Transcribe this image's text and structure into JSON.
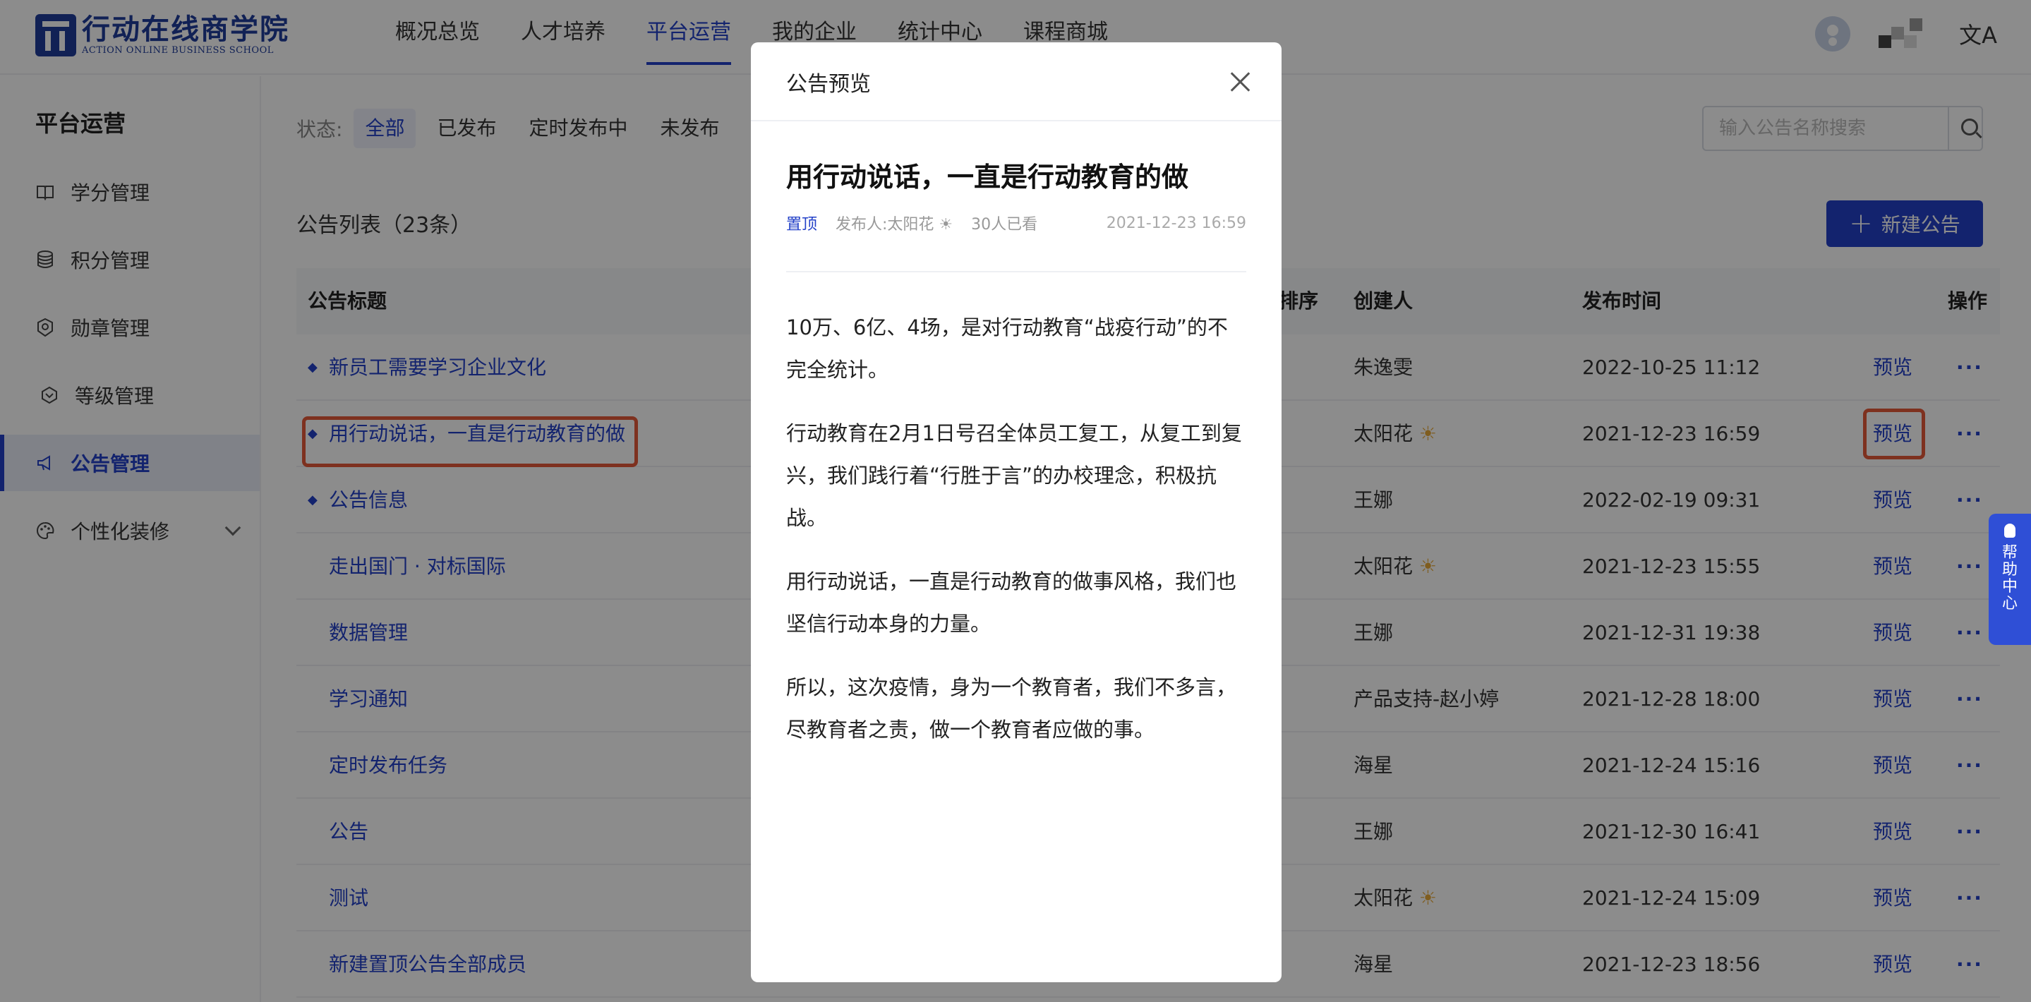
{
  "header": {
    "logo_cn": "行动在线商学院",
    "logo_en": "ACTION ONLINE BUSINESS SCHOOL",
    "nav": [
      {
        "label": "概况总览",
        "active": false
      },
      {
        "label": "人才培养",
        "active": false
      },
      {
        "label": "平台运营",
        "active": true
      },
      {
        "label": "我的企业",
        "active": false
      },
      {
        "label": "统计中心",
        "active": false
      },
      {
        "label": "课程商城",
        "active": false
      }
    ],
    "lang_icon": "translate-icon"
  },
  "sidebar": {
    "title": "平台运营",
    "items": [
      {
        "label": "学分管理",
        "icon": "book-icon"
      },
      {
        "label": "积分管理",
        "icon": "database-icon"
      },
      {
        "label": "勋章管理",
        "icon": "medal-icon"
      },
      {
        "label": "等级管理",
        "icon": "level-icon"
      },
      {
        "label": "公告管理",
        "icon": "megaphone-icon",
        "active": true
      },
      {
        "label": "个性化装修",
        "icon": "palette-icon"
      }
    ]
  },
  "filter": {
    "label": "状态:",
    "options": [
      "全部",
      "已发布",
      "定时发布中",
      "未发布"
    ],
    "selected": "全部"
  },
  "search": {
    "placeholder": "输入公告名称搜索"
  },
  "list": {
    "title": "公告列表（23条）",
    "new_button": "新建公告",
    "columns": [
      "公告标题",
      "排序",
      "创建人",
      "发布时间",
      "操作"
    ],
    "rows": [
      {
        "title": "新员工需要学习企业文化",
        "pinned": true,
        "creator": "朱逸雯",
        "time": "2022-10-25 11:12",
        "action": "预览"
      },
      {
        "title": "用行动说话，一直是行动教育的做",
        "pinned": true,
        "creator": "太阳花",
        "time": "2021-12-23 16:59",
        "action": "预览"
      },
      {
        "title": "公告信息",
        "pinned": true,
        "creator": "王娜",
        "time": "2022-02-19 09:31",
        "action": "预览"
      },
      {
        "title": "走出国门 · 对标国际",
        "pinned": false,
        "creator": "太阳花",
        "time": "2021-12-23 15:55",
        "action": "预览"
      },
      {
        "title": "数据管理",
        "pinned": false,
        "creator": "王娜",
        "time": "2021-12-31 19:38",
        "action": "预览"
      },
      {
        "title": "学习通知",
        "pinned": false,
        "creator": "产品支持-赵小婷",
        "time": "2021-12-28 18:00",
        "action": "预览"
      },
      {
        "title": "定时发布任务",
        "pinned": false,
        "creator": "海星",
        "time": "2021-12-24 15:16",
        "action": "预览"
      },
      {
        "title": "公告",
        "pinned": false,
        "creator": "王娜",
        "time": "2021-12-30 16:41",
        "action": "预览"
      },
      {
        "title": "测试",
        "pinned": false,
        "creator": "太阳花",
        "time": "2021-12-24 15:09",
        "action": "预览"
      },
      {
        "title": "新建置顶公告全部成员",
        "pinned": false,
        "creator": "海星",
        "time": "2021-12-23 18:56",
        "action": "预览"
      }
    ],
    "more_label": "···"
  },
  "modal": {
    "title": "公告预览",
    "article_title": "用行动说话，一直是行动教育的做",
    "tag": "置顶",
    "publisher": "发布人:太阳花",
    "views": "30人已看",
    "date": "2021-12-23 16:59",
    "paragraphs": [
      "10万、6亿、4场，是对行动教育“战疫行动”的不完全统计。",
      "行动教育在2月1日号召全体员工复工，从复工到复兴，我们践行着“行胜于言”的办校理念，积极抗战。",
      "用行动说话，一直是行动教育的做事风格，我们也坚信行动本身的力量。",
      "所以，这次疫情，身为一个教育者，我们不多言，尽教育者之责，做一个教育者应做的事。"
    ]
  },
  "help": {
    "label": "帮助中心"
  },
  "colors": {
    "primary": "#2341c8",
    "highlight": "#e55a3a",
    "mask": "rgba(0,0,0,0.45)"
  }
}
